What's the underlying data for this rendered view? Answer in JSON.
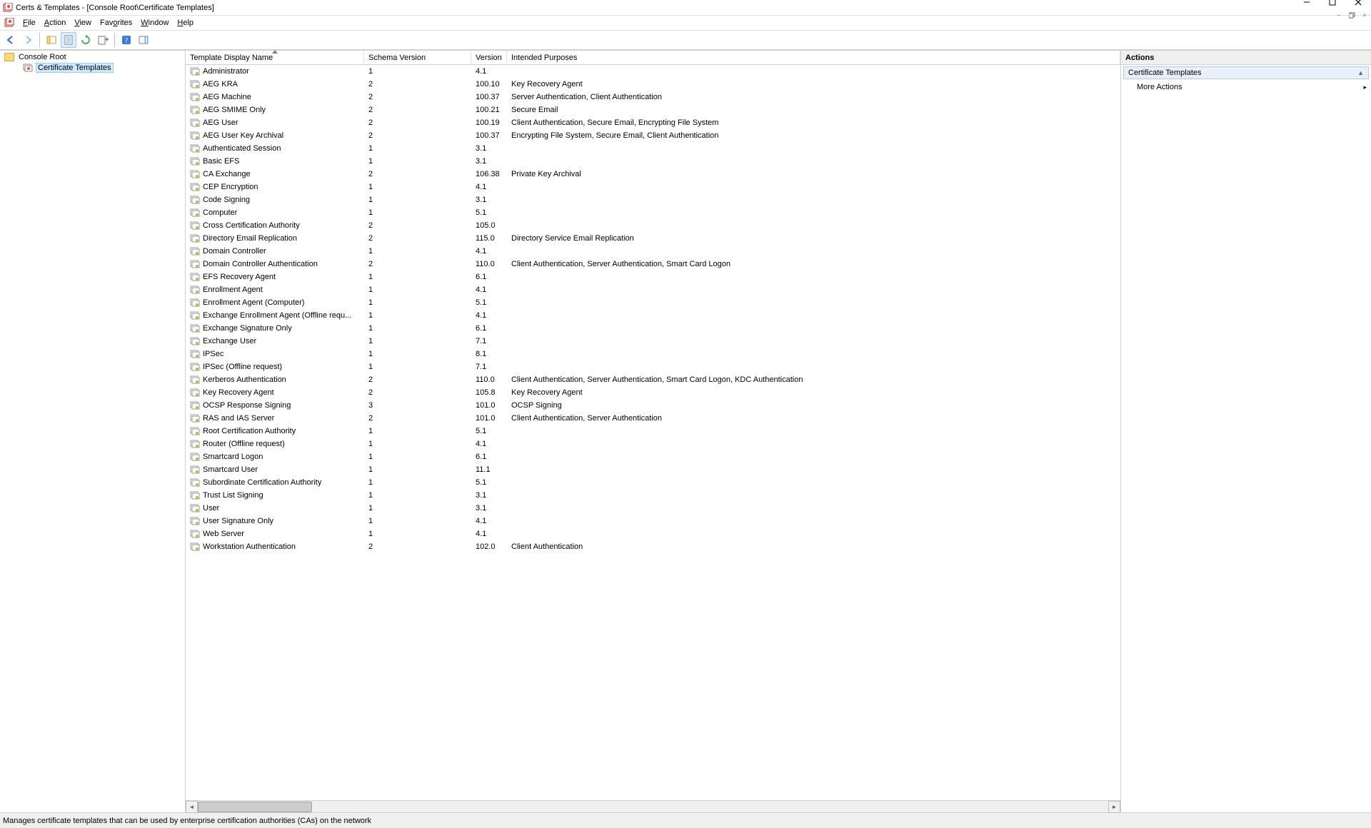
{
  "window": {
    "title": "Certs & Templates - [Console Root\\Certificate Templates]"
  },
  "menu": {
    "items": [
      "File",
      "Action",
      "View",
      "Favorites",
      "Window",
      "Help"
    ],
    "accel": [
      "F",
      "A",
      "V",
      "o",
      "W",
      "H"
    ]
  },
  "toolbar": {
    "back": "Back",
    "forward": "Forward",
    "up": "Up",
    "show_hide": "Show/Hide Console Tree",
    "properties": "Properties",
    "refresh": "Refresh",
    "export": "Export List",
    "help": "Help",
    "actionpane": "Show/Hide Action Pane"
  },
  "tree": {
    "root": "Console Root",
    "child": "Certificate Templates"
  },
  "columns": {
    "name": "Template Display Name",
    "schema": "Schema Version",
    "version": "Version",
    "purposes": "Intended Purposes"
  },
  "templates": [
    {
      "name": "Administrator",
      "schema": "1",
      "version": "4.1",
      "purposes": ""
    },
    {
      "name": "AEG KRA",
      "schema": "2",
      "version": "100.10",
      "purposes": "Key Recovery Agent"
    },
    {
      "name": "AEG Machine",
      "schema": "2",
      "version": "100.37",
      "purposes": "Server Authentication, Client Authentication"
    },
    {
      "name": "AEG SMIME Only",
      "schema": "2",
      "version": "100.21",
      "purposes": "Secure Email"
    },
    {
      "name": "AEG User",
      "schema": "2",
      "version": "100.19",
      "purposes": "Client Authentication, Secure Email, Encrypting File System"
    },
    {
      "name": "AEG User Key Archival",
      "schema": "2",
      "version": "100.37",
      "purposes": "Encrypting File System, Secure Email, Client Authentication"
    },
    {
      "name": "Authenticated Session",
      "schema": "1",
      "version": "3.1",
      "purposes": ""
    },
    {
      "name": "Basic EFS",
      "schema": "1",
      "version": "3.1",
      "purposes": ""
    },
    {
      "name": "CA Exchange",
      "schema": "2",
      "version": "106.38",
      "purposes": "Private Key Archival"
    },
    {
      "name": "CEP Encryption",
      "schema": "1",
      "version": "4.1",
      "purposes": ""
    },
    {
      "name": "Code Signing",
      "schema": "1",
      "version": "3.1",
      "purposes": ""
    },
    {
      "name": "Computer",
      "schema": "1",
      "version": "5.1",
      "purposes": ""
    },
    {
      "name": "Cross Certification Authority",
      "schema": "2",
      "version": "105.0",
      "purposes": ""
    },
    {
      "name": "Directory Email Replication",
      "schema": "2",
      "version": "115.0",
      "purposes": "Directory Service Email Replication"
    },
    {
      "name": "Domain Controller",
      "schema": "1",
      "version": "4.1",
      "purposes": ""
    },
    {
      "name": "Domain Controller Authentication",
      "schema": "2",
      "version": "110.0",
      "purposes": "Client Authentication, Server Authentication, Smart Card Logon"
    },
    {
      "name": "EFS Recovery Agent",
      "schema": "1",
      "version": "6.1",
      "purposes": ""
    },
    {
      "name": "Enrollment Agent",
      "schema": "1",
      "version": "4.1",
      "purposes": ""
    },
    {
      "name": "Enrollment Agent (Computer)",
      "schema": "1",
      "version": "5.1",
      "purposes": ""
    },
    {
      "name": "Exchange Enrollment Agent (Offline requ...",
      "schema": "1",
      "version": "4.1",
      "purposes": ""
    },
    {
      "name": "Exchange Signature Only",
      "schema": "1",
      "version": "6.1",
      "purposes": ""
    },
    {
      "name": "Exchange User",
      "schema": "1",
      "version": "7.1",
      "purposes": ""
    },
    {
      "name": "IPSec",
      "schema": "1",
      "version": "8.1",
      "purposes": ""
    },
    {
      "name": "IPSec (Offline request)",
      "schema": "1",
      "version": "7.1",
      "purposes": ""
    },
    {
      "name": "Kerberos Authentication",
      "schema": "2",
      "version": "110.0",
      "purposes": "Client Authentication, Server Authentication, Smart Card Logon, KDC Authentication"
    },
    {
      "name": "Key Recovery Agent",
      "schema": "2",
      "version": "105.8",
      "purposes": "Key Recovery Agent"
    },
    {
      "name": "OCSP Response Signing",
      "schema": "3",
      "version": "101.0",
      "purposes": "OCSP Signing"
    },
    {
      "name": "RAS and IAS Server",
      "schema": "2",
      "version": "101.0",
      "purposes": "Client Authentication, Server Authentication"
    },
    {
      "name": "Root Certification Authority",
      "schema": "1",
      "version": "5.1",
      "purposes": ""
    },
    {
      "name": "Router (Offline request)",
      "schema": "1",
      "version": "4.1",
      "purposes": ""
    },
    {
      "name": "Smartcard Logon",
      "schema": "1",
      "version": "6.1",
      "purposes": ""
    },
    {
      "name": "Smartcard User",
      "schema": "1",
      "version": "11.1",
      "purposes": ""
    },
    {
      "name": "Subordinate Certification Authority",
      "schema": "1",
      "version": "5.1",
      "purposes": ""
    },
    {
      "name": "Trust List Signing",
      "schema": "1",
      "version": "3.1",
      "purposes": ""
    },
    {
      "name": "User",
      "schema": "1",
      "version": "3.1",
      "purposes": ""
    },
    {
      "name": "User Signature Only",
      "schema": "1",
      "version": "4.1",
      "purposes": ""
    },
    {
      "name": "Web Server",
      "schema": "1",
      "version": "4.1",
      "purposes": ""
    },
    {
      "name": "Workstation Authentication",
      "schema": "2",
      "version": "102.0",
      "purposes": "Client Authentication"
    }
  ],
  "actions": {
    "title": "Actions",
    "section": "Certificate Templates",
    "more": "More Actions"
  },
  "status": {
    "text": "Manages certificate templates that can be used by enterprise certification authorities (CAs) on the network"
  }
}
